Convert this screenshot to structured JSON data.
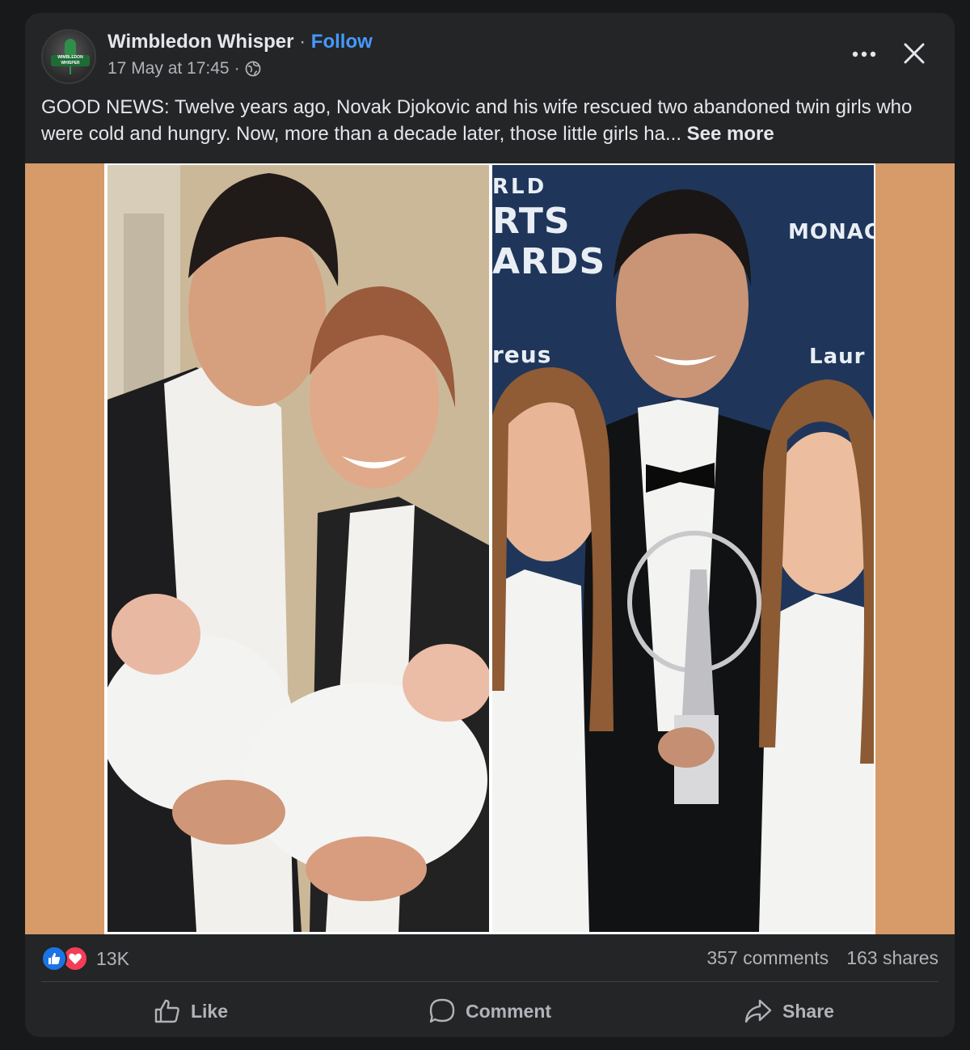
{
  "post": {
    "page_name": "Wimbledon Whisper",
    "separator": "·",
    "follow_label": "Follow",
    "timestamp": "17 May at 17:45",
    "meta_separator": "·",
    "audience_icon": "globe-icon",
    "body": "GOOD NEWS: Twelve years ago, Novak Djokovic and his wife rescued two abandoned twin girls who were cold and hungry. Now, more than a decade later, those little girls ha...",
    "see_more_label": "See more",
    "avatar_text": "WIMBLEDON WHISPER"
  },
  "image": {
    "background_color": "#d69b68",
    "right_panel_texts": [
      "RLD",
      "RTS",
      "ARDS",
      "reus",
      "MONAC",
      "Laur"
    ]
  },
  "reactions": {
    "icons": [
      "like-icon",
      "love-icon"
    ],
    "count": "13K",
    "comments": "357 comments",
    "shares": "163 shares"
  },
  "actions": {
    "like_label": "Like",
    "comment_label": "Comment",
    "share_label": "Share"
  },
  "colors": {
    "card": "#242526",
    "link": "#4599ff",
    "like": "#1b74e4",
    "love": "#f33e58"
  }
}
